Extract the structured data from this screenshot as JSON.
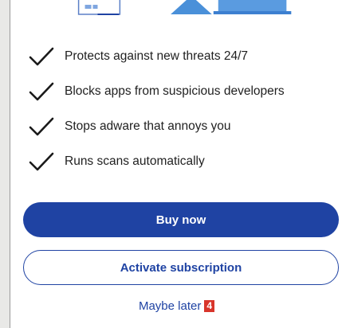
{
  "features": [
    {
      "label": "Protects against new threats 24/7",
      "icon": "check-icon"
    },
    {
      "label": "Blocks apps from suspicious developers",
      "icon": "check-icon"
    },
    {
      "label": "Stops adware that annoys you",
      "icon": "check-icon"
    },
    {
      "label": "Runs scans automatically",
      "icon": "check-icon"
    }
  ],
  "buttons": {
    "buy_now": "Buy now",
    "activate": "Activate subscription",
    "maybe_later": "Maybe later"
  },
  "badge": "4",
  "colors": {
    "accent": "#1f43a3",
    "badge": "#d8352b",
    "illustration": "#4a90d9"
  }
}
